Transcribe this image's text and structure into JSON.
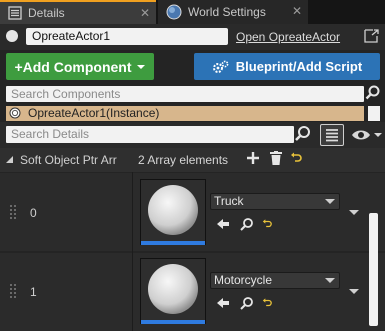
{
  "tabs": [
    {
      "label": "Details",
      "icon": "details-panel-icon",
      "close": "✕"
    },
    {
      "label": "World Settings",
      "icon": "world-globe-icon",
      "close": "✕"
    }
  ],
  "actor": {
    "name_value": "OpreateActor1",
    "open_link": "Open OpreateActor"
  },
  "buttons": {
    "add_component": "+Add Component",
    "blueprint": "Blueprint/Add Script"
  },
  "search_components": {
    "placeholder": "Search Components"
  },
  "instance": {
    "label": "OpreateActor1(Instance)"
  },
  "search_details": {
    "placeholder": "Search Details"
  },
  "array": {
    "property_name": "Soft Object Ptr Arr",
    "count_label": "2 Array elements",
    "elements": [
      {
        "index": "0",
        "value": "Truck"
      },
      {
        "index": "1",
        "value": "Motorcycle"
      }
    ]
  },
  "colors": {
    "add_button": "#3e9c3f",
    "blueprint_button": "#2c73b6",
    "instance_row": "#d7b68c",
    "tab_accent": "#f0a020",
    "reset_arrow": "#e8c23a"
  }
}
